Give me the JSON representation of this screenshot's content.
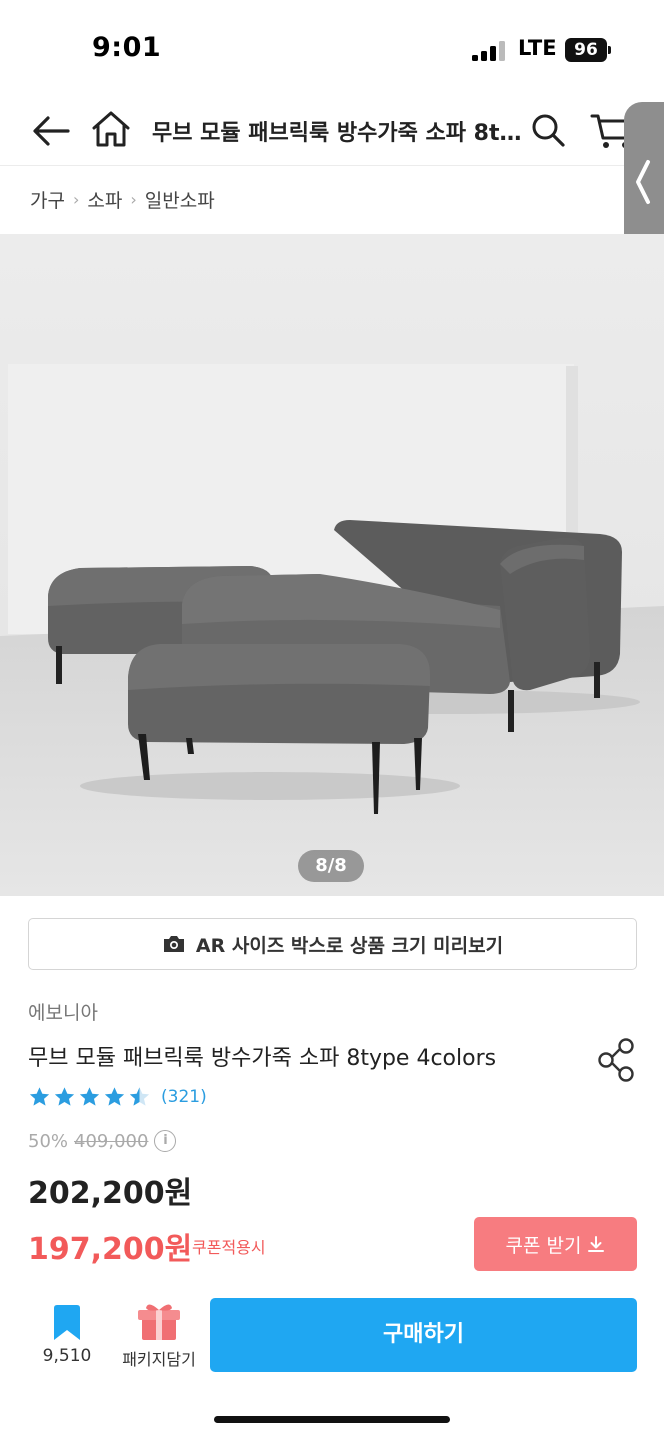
{
  "status_bar": {
    "time": "9:01",
    "network": "LTE",
    "battery": "96"
  },
  "nav": {
    "title": "무브 모듈 패브릭룩 방수가죽 소파 8type 4colors",
    "back_icon": "arrow-left-icon",
    "home_icon": "home-icon",
    "search_icon": "search-icon",
    "cart_icon": "cart-icon",
    "side_handle_icon": "chevron-left-icon"
  },
  "breadcrumb": [
    "가구",
    "소파",
    "일반소파"
  ],
  "gallery": {
    "current": 8,
    "total": 8,
    "indicator": "8/8"
  },
  "ar_button": {
    "label": "AR 사이즈 박스로 상품 크기 미리보기",
    "icon": "camera-icon"
  },
  "product": {
    "brand": "에보니아",
    "name": "무브 모듈 패브릭룩 방수가죽 소파 8type 4colors",
    "rating": 4.5,
    "review_count": "(321)",
    "discount_rate": "50%",
    "original_price": "409,000",
    "sale_price": "202,200원",
    "coupon_price": "197,200원",
    "coupon_note": "쿠폰적용시",
    "coupon_button": "쿠폰 받기"
  },
  "bottom_bar": {
    "bookmark_count": "9,510",
    "package_label": "패키지담기",
    "buy_label": "구매하기"
  },
  "colors": {
    "accent_blue": "#1FA7F2",
    "coupon_red": "#F25A5A",
    "coupon_button_bg": "#F77C80",
    "star_blue": "#2B9DE0"
  }
}
